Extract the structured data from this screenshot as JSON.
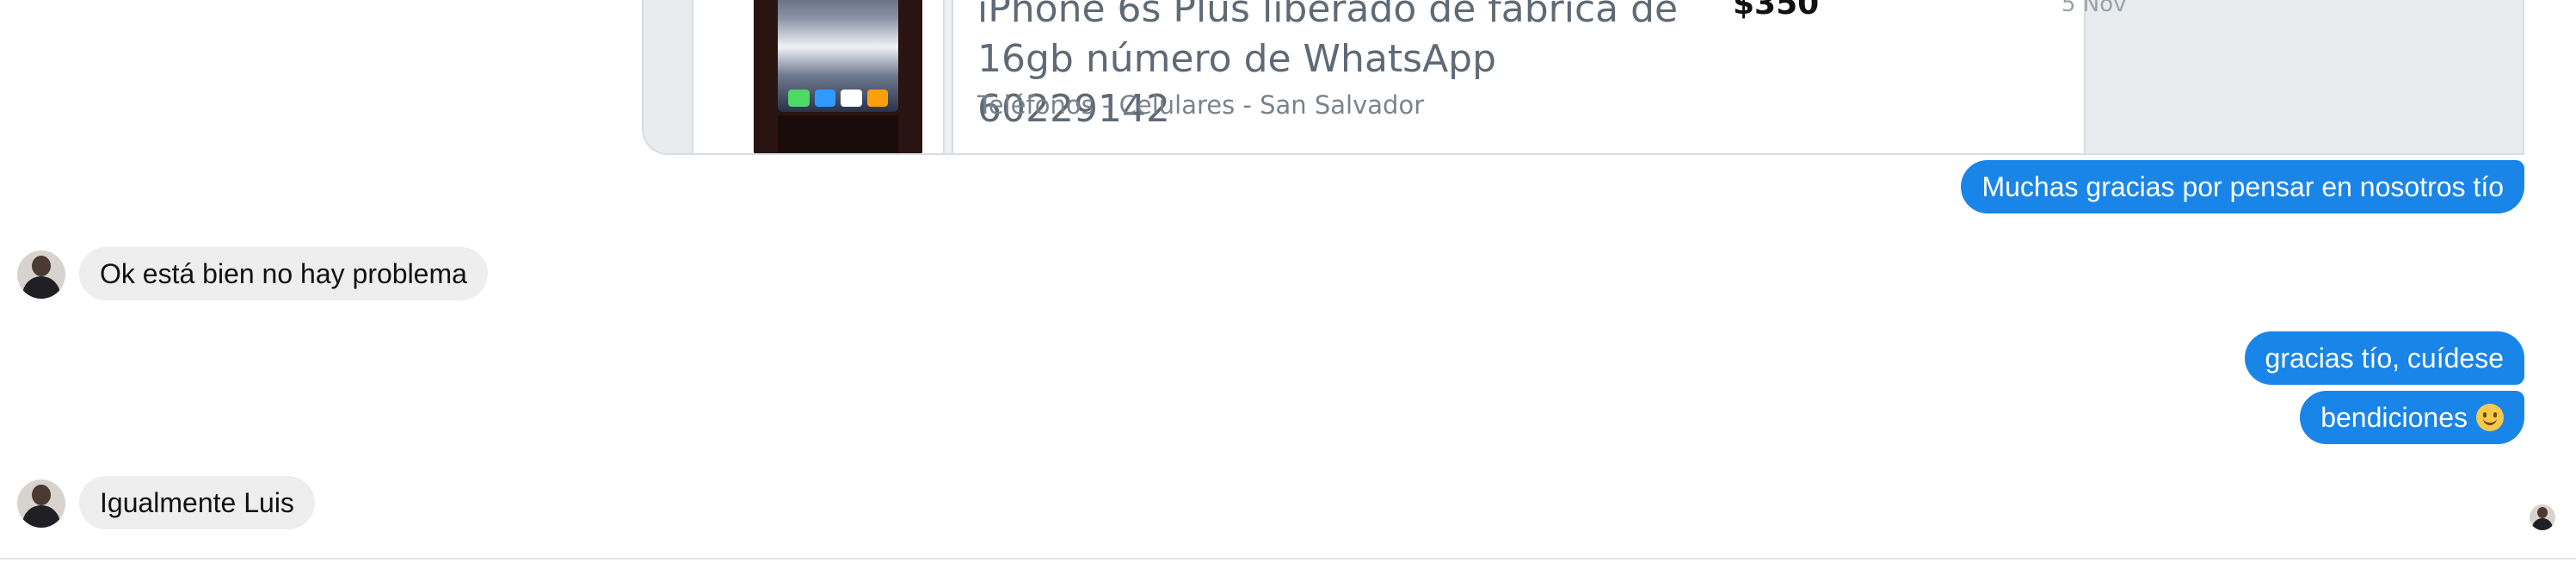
{
  "link_preview": {
    "title": "iPhone 6s Plus liberado de fábrica de 16gb número de WhatsApp 60229142",
    "category": "Teléfonos - Celulares - San Salvador",
    "price": "$350",
    "date": "5 Nov"
  },
  "messages": [
    {
      "direction": "outgoing",
      "text": "Muchas gracias por pensar en nosotros tío"
    },
    {
      "direction": "incoming",
      "text": "Ok está bien no hay problema"
    },
    {
      "direction": "outgoing",
      "text": "gracias tío, cuídese"
    },
    {
      "direction": "outgoing",
      "text": "bendiciones",
      "emoji": "slightly-smiling-face"
    },
    {
      "direction": "incoming",
      "text": "Igualmente Luis"
    }
  ],
  "colors": {
    "outgoing_bubble": "#1a85e8",
    "incoming_bubble": "#eeeeee",
    "preview_title": "#5f6a76"
  },
  "icons": {
    "contact_avatar": "contact-avatar-icon",
    "seen_avatar": "seen-avatar-icon",
    "emoji": "smiley-emoji-icon"
  }
}
